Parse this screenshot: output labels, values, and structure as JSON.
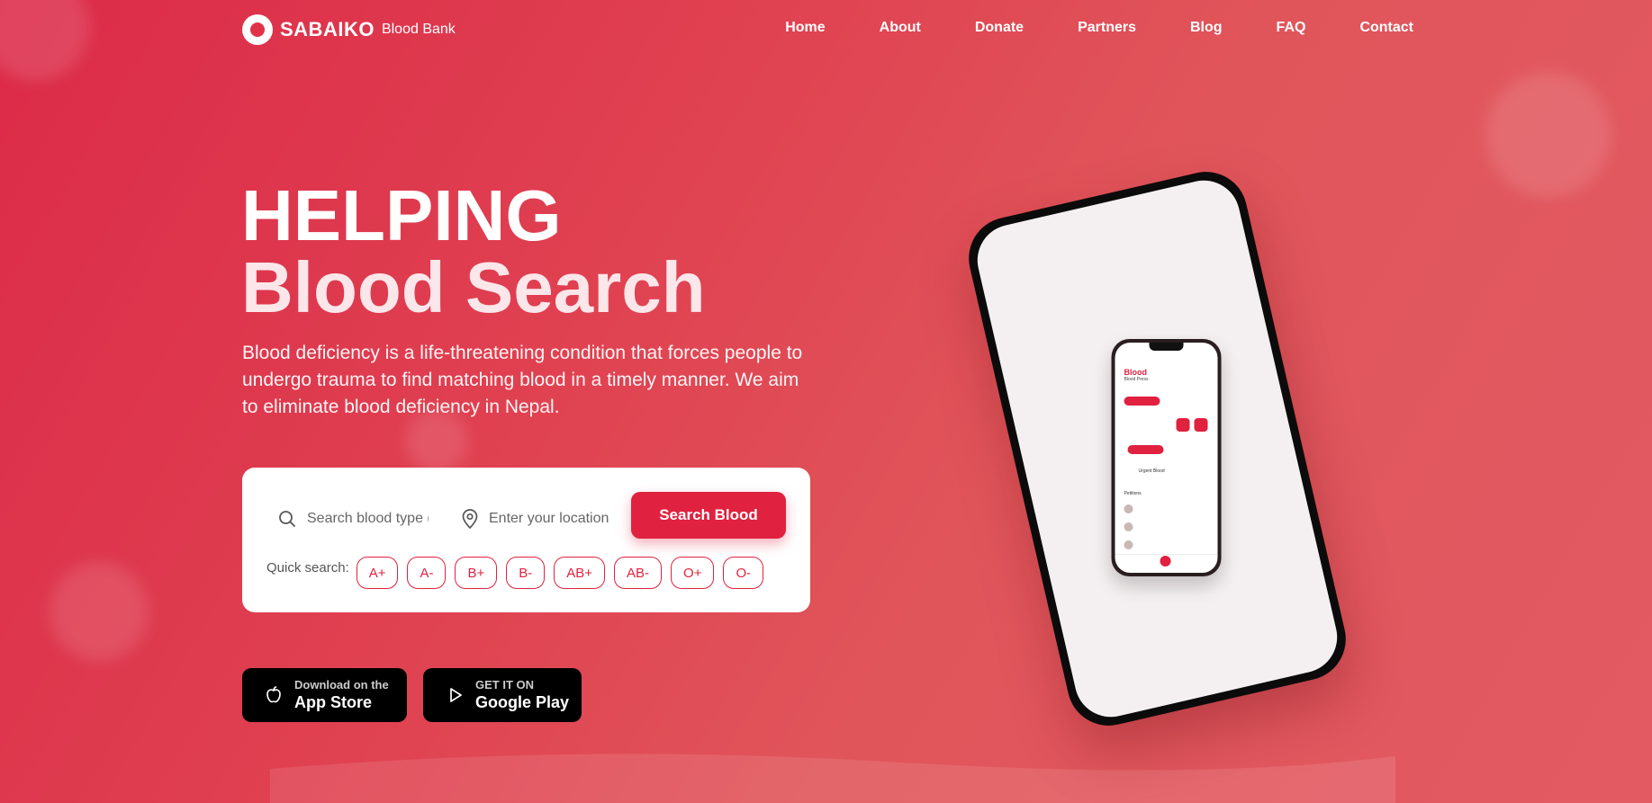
{
  "brand": {
    "name": "SABAIKO",
    "tagline": "Blood Bank"
  },
  "nav": [
    "Home",
    "About",
    "Donate",
    "Partners",
    "Blog",
    "FAQ",
    "Contact"
  ],
  "hero": {
    "title_line1": "HELPING",
    "title_line2": "Blood Search",
    "description": "Blood deficiency is a life-threatening condition that forces people to undergo trauma to find matching blood in a timely manner. We aim to eliminate blood deficiency in Nepal."
  },
  "search": {
    "blood_placeholder": "Search blood type (",
    "location_placeholder": "Enter your location",
    "button_label": "Search Blood",
    "quick_label": "Quick search:",
    "blood_types": [
      "A+",
      "A-",
      "B+",
      "B-",
      "AB+",
      "AB-",
      "O+",
      "O-"
    ]
  },
  "stores": {
    "apple": {
      "small": "Download on the",
      "big": "App Store"
    },
    "google": {
      "small": "GET IT ON",
      "big": "Google Play"
    }
  },
  "mini_app": {
    "title": "Blood",
    "subtitle": "Blood Press",
    "section_urgent": "Urgent Blood",
    "section_requests": "Petitions"
  },
  "colors": {
    "accent": "#e0213f",
    "background_start": "#dc2a48",
    "background_end": "#e35a63"
  }
}
